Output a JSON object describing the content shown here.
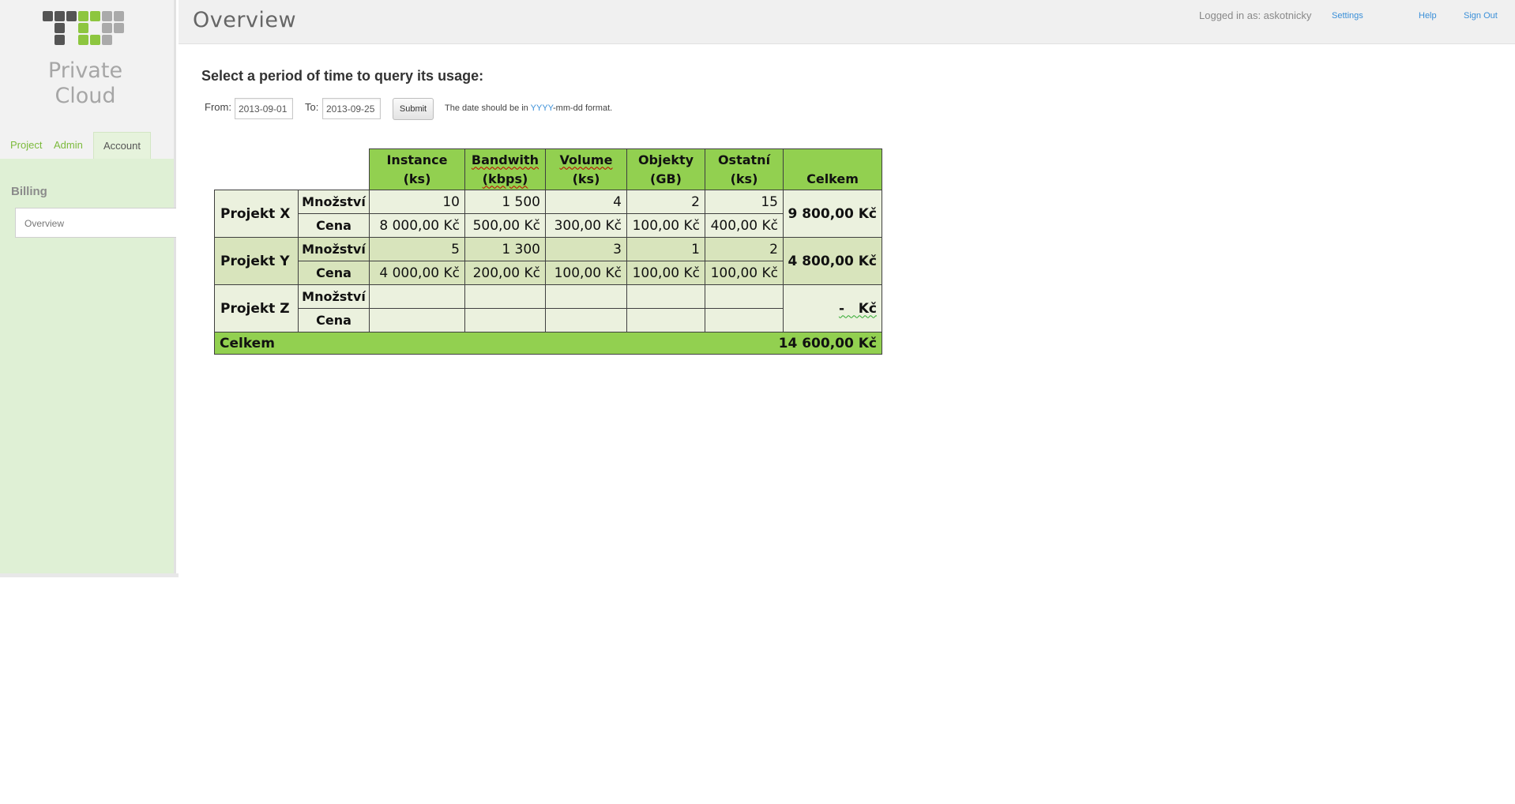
{
  "app": {
    "logo_line1": "Private",
    "logo_line2": "Cloud"
  },
  "sidebar": {
    "tabs": [
      {
        "label": "Project"
      },
      {
        "label": "Admin"
      },
      {
        "label": "Account",
        "active": true
      }
    ],
    "panel_heading": "Billing",
    "items": [
      {
        "label": "Overview",
        "active": true
      }
    ]
  },
  "header": {
    "title": "Overview",
    "logged_in_text": "Logged in as: askotnicky",
    "settings_label": "Settings",
    "help_label": "Help",
    "signout_label": "Sign Out"
  },
  "query": {
    "heading": "Select a period of time to query its usage:",
    "from_label": "From:",
    "from_value": "2013-09-01",
    "to_label": "To:",
    "to_value": "2013-09-25",
    "submit_label": "Submit",
    "hint_pre": "The date should be in ",
    "hint_yyyy": "YYYY",
    "hint_post": "-mm-dd format."
  },
  "billing_table": {
    "columns": [
      {
        "line1": "Instance",
        "line2": "(ks)"
      },
      {
        "line1": "Bandwith",
        "line2": "(kbps)"
      },
      {
        "line1": "Volume",
        "line2": "(ks)"
      },
      {
        "line1": "Objekty",
        "line2": "(GB)"
      },
      {
        "line1": "Ostatní",
        "line2": "(ks)"
      }
    ],
    "total_header": "Celkem",
    "sub_labels": {
      "quantity": "Množství",
      "price": "Cena"
    },
    "rows": [
      {
        "name": "Projekt X",
        "quantity": [
          "10",
          "1 500",
          "4",
          "2",
          "15"
        ],
        "price": [
          "8 000,00 Kč",
          "500,00 Kč",
          "300,00 Kč",
          "100,00 Kč",
          "400,00 Kč"
        ],
        "total": "9 800,00 Kč"
      },
      {
        "name": "Projekt Y",
        "quantity": [
          "5",
          "1 300",
          "3",
          "1",
          "2"
        ],
        "price": [
          "4 000,00 Kč",
          "200,00 Kč",
          "100,00 Kč",
          "100,00 Kč",
          "100,00 Kč"
        ],
        "total": "4 800,00 Kč"
      },
      {
        "name": "Projekt Z",
        "quantity": [
          "",
          "",
          "",
          "",
          ""
        ],
        "price": [
          "",
          "",
          "",
          "",
          ""
        ],
        "total": "-   Kč"
      }
    ],
    "grand_total_label": "Celkem",
    "grand_total_value": "14 600,00 Kč"
  },
  "colors": {
    "header_green": "#92d050",
    "cell_light": "#ebf1de",
    "cell_alt": "#d8e4bc",
    "link_blue": "#3a8fd8",
    "tab_green": "#7cba3c"
  }
}
